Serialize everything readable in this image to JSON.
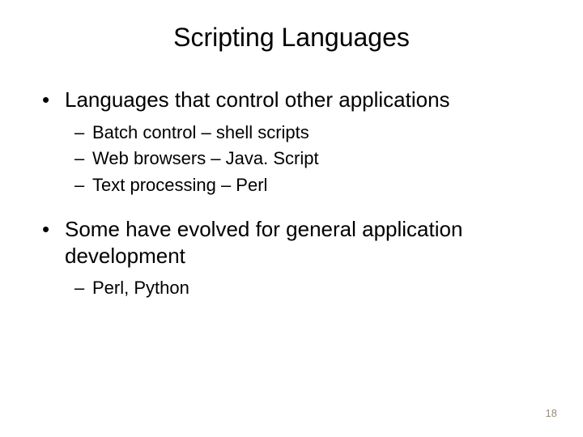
{
  "title": "Scripting Languages",
  "bullets": {
    "b1": "Languages that control other applications",
    "b1_sub1": "Batch control – shell scripts",
    "b1_sub2": "Web browsers – Java. Script",
    "b1_sub3": "Text processing – Perl",
    "b2": "Some have evolved for general application development",
    "b2_sub1": "Perl, Python"
  },
  "page_number": "18"
}
